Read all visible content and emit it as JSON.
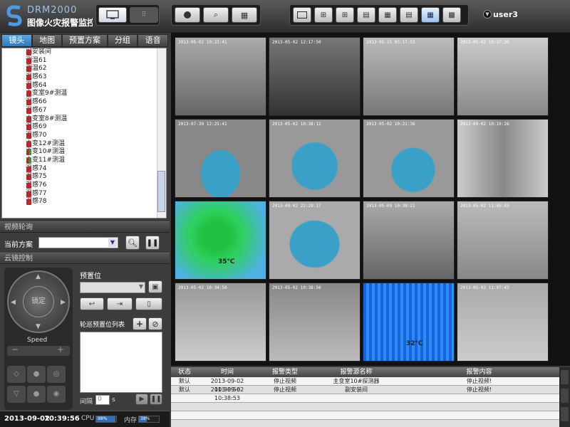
{
  "app": {
    "brand": "DRM2000",
    "title": "图像火灾报警监控"
  },
  "user": {
    "name": "user3"
  },
  "tabs": [
    {
      "label": "镜头"
    },
    {
      "label": "地图"
    },
    {
      "label": "预置方案"
    },
    {
      "label": "分组"
    },
    {
      "label": "语音"
    }
  ],
  "tree": [
    "副安装间",
    "测温61",
    "测温62",
    "温感63",
    "温感64",
    "主变室9#测温",
    "温感66",
    "温感67",
    "主变室8#测温",
    "温感69",
    "温感70",
    "主变12#测温",
    "主变10#测温",
    "主变11#测温",
    "温感74",
    "温感75",
    "温感76",
    "温感77",
    "温感78"
  ],
  "patrol": {
    "header": "视频轮询",
    "label": "当前方案",
    "value": ""
  },
  "ptz": {
    "header": "云镜控制",
    "center": "锁定",
    "speed": "Speed",
    "preset_label": "预置位",
    "preset_list_label": "轮巡预置位列表",
    "interval_label": "间隔",
    "interval_value": "0",
    "interval_unit": "s"
  },
  "cells": [
    {
      "ts": "2013-05-02 10:23:41"
    },
    {
      "ts": "2013-05-02 12:17:50"
    },
    {
      "ts": "2013-05-15 03:17:53"
    },
    {
      "ts": "2013-05-02 10:37:30"
    },
    {
      "ts": "2013-07-30 12:25:41"
    },
    {
      "ts": "2013-05-02 10:38:12"
    },
    {
      "ts": "2013-05-02 10:21:36"
    },
    {
      "ts": "2013-09-02 10:19:26"
    },
    {
      "ts": "",
      "temp": "35℃"
    },
    {
      "ts": "2013-09-02 22:29:17"
    },
    {
      "ts": "2013-05-09 10:39:21"
    },
    {
      "ts": "2013-05-02 11:05:43"
    },
    {
      "ts": "2013-05-02 10:34:50"
    },
    {
      "ts": "2013-05-02 10:38:56"
    },
    {
      "ts": "",
      "temp": "32℃"
    },
    {
      "ts": "2013-05-02 11:07:43"
    }
  ],
  "alarm": {
    "headers": [
      "状态",
      "时间",
      "报警类型",
      "报警源名称",
      "报警内容"
    ],
    "rows": [
      [
        "默认",
        "2013-09-02 10:38:56",
        "停止视频",
        "主变室10#探测器",
        "停止视频!"
      ],
      [
        "默认",
        "2013-09-02 10:38:53",
        "停止视频",
        "副安装间",
        "停止视频!"
      ]
    ]
  },
  "status": {
    "date": "2013-09-02",
    "time": "10:39:56",
    "cpu_label": "CPU",
    "cpu_value": "98%",
    "mem_label": "内存",
    "mem_value": "38%",
    "cpu_fraction": 0.98,
    "mem_fraction": 0.38
  }
}
